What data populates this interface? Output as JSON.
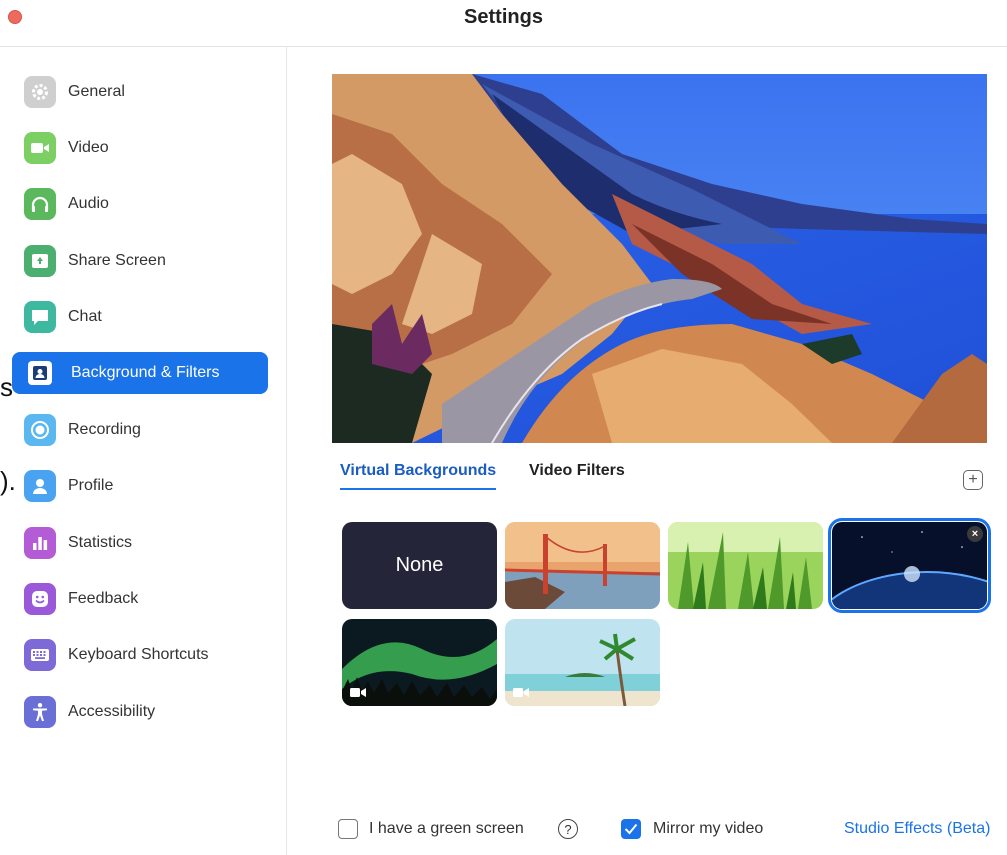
{
  "window": {
    "title": "Settings"
  },
  "sidebar": {
    "items": [
      {
        "label": "General",
        "icon": "gear-icon",
        "color": "#c9c9c9"
      },
      {
        "label": "Video",
        "icon": "camera-icon",
        "color": "#7ccf63"
      },
      {
        "label": "Audio",
        "icon": "headphones-icon",
        "color": "#5cb85c"
      },
      {
        "label": "Share Screen",
        "icon": "share-screen-icon",
        "color": "#4caf6f"
      },
      {
        "label": "Chat",
        "icon": "chat-icon",
        "color": "#3fb8a0"
      },
      {
        "label": "Background & Filters",
        "icon": "portrait-icon",
        "color": "#1a73e8",
        "active": true
      },
      {
        "label": "Recording",
        "icon": "record-icon",
        "color": "#5ab7f0"
      },
      {
        "label": "Profile",
        "icon": "person-icon",
        "color": "#4aa3f0"
      },
      {
        "label": "Statistics",
        "icon": "bar-chart-icon",
        "color": "#b45bd6"
      },
      {
        "label": "Feedback",
        "icon": "smiley-icon",
        "color": "#9b59d9"
      },
      {
        "label": "Keyboard Shortcuts",
        "icon": "keyboard-icon",
        "color": "#7e6ad6"
      },
      {
        "label": "Accessibility",
        "icon": "accessibility-icon",
        "color": "#6a6fd6"
      }
    ],
    "edge_glyphs": [
      "s",
      ")."
    ]
  },
  "main": {
    "tabs": [
      {
        "label": "Virtual Backgrounds",
        "active": true
      },
      {
        "label": "Video Filters",
        "active": false
      }
    ],
    "add_button_icon": "plus-icon",
    "backgrounds": [
      {
        "label": "None",
        "kind": "none"
      },
      {
        "kind": "golden-gate-bridge"
      },
      {
        "kind": "grass"
      },
      {
        "kind": "earth-from-space",
        "selected": true,
        "remove_icon": "close-icon",
        "remove_label": "×"
      },
      {
        "kind": "aurora",
        "video": true
      },
      {
        "kind": "beach",
        "video": true
      }
    ]
  },
  "footer": {
    "green_screen": {
      "label": "I have a green screen",
      "checked": false
    },
    "help_icon": "?",
    "mirror": {
      "label": "Mirror my video",
      "checked": true
    },
    "studio_effects": "Studio Effects (Beta)"
  },
  "colors": {
    "accent": "#1a73e8",
    "close_button": "#ee6a5f"
  }
}
